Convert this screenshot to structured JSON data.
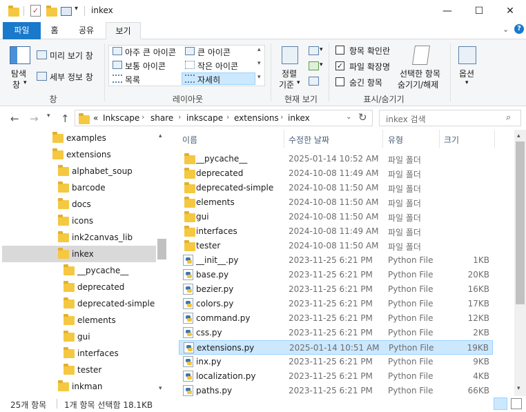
{
  "window": {
    "title": "inkex",
    "minimize": "—",
    "maximize": "☐",
    "close": "✕"
  },
  "tabs": [
    {
      "label": "파일"
    },
    {
      "label": "홈"
    },
    {
      "label": "공유"
    },
    {
      "label": "보기"
    }
  ],
  "ribbon": {
    "pane_group": {
      "nav_pane_label1": "탐색",
      "nav_pane_label2": "창",
      "preview_pane": "미리 보기 창",
      "details_pane": "세부 정보 창",
      "group_label": "창"
    },
    "layout_group": {
      "extra_large": "아주 큰 아이콘",
      "large": "큰 아이콘",
      "medium": "보통 아이콘",
      "small": "작은 아이콘",
      "list": "목록",
      "details": "자세히",
      "group_label": "레이아웃"
    },
    "view_group": {
      "sort_label1": "정렬",
      "sort_label2": "기준",
      "group_label": "현재 보기"
    },
    "show_hide_group": {
      "item_checkboxes": "항목 확인란",
      "item_checkboxes_checked": false,
      "file_extensions": "파일 확장명",
      "file_extensions_checked": true,
      "hidden_items": "숨긴 항목",
      "hidden_items_checked": false,
      "hide_selected1": "선택한 항목",
      "hide_selected2": "숨기기/해제",
      "group_label": "표시/숨기기"
    },
    "options": {
      "label": "옵션"
    }
  },
  "address": {
    "overflow": "«",
    "crumbs": [
      "Inkscape",
      "share",
      "inkscape",
      "extensions",
      "inkex"
    ],
    "search_placeholder": "inkex 검색"
  },
  "nav_tree": [
    {
      "label": "examples",
      "level": 0
    },
    {
      "label": "extensions",
      "level": 0
    },
    {
      "label": "alphabet_soup",
      "level": 1
    },
    {
      "label": "barcode",
      "level": 1
    },
    {
      "label": "docs",
      "level": 1
    },
    {
      "label": "icons",
      "level": 1
    },
    {
      "label": "ink2canvas_lib",
      "level": 1
    },
    {
      "label": "inkex",
      "level": 1,
      "selected": true
    },
    {
      "label": "__pycache__",
      "level": 2
    },
    {
      "label": "deprecated",
      "level": 2
    },
    {
      "label": "deprecated-simple",
      "level": 2
    },
    {
      "label": "elements",
      "level": 2
    },
    {
      "label": "gui",
      "level": 2
    },
    {
      "label": "interfaces",
      "level": 2
    },
    {
      "label": "tester",
      "level": 2
    },
    {
      "label": "inkman",
      "level": 1
    }
  ],
  "columns": {
    "name": "이름",
    "date": "수정한 날짜",
    "type": "유형",
    "size": "크기"
  },
  "files": [
    {
      "name": "__pycache__",
      "date": "2025-01-14 10:52 AM",
      "type": "파일 폴더",
      "size": "",
      "kind": "folder"
    },
    {
      "name": "deprecated",
      "date": "2024-10-08 11:49 AM",
      "type": "파일 폴더",
      "size": "",
      "kind": "folder"
    },
    {
      "name": "deprecated-simple",
      "date": "2024-10-08 11:50 AM",
      "type": "파일 폴더",
      "size": "",
      "kind": "folder"
    },
    {
      "name": "elements",
      "date": "2024-10-08 11:50 AM",
      "type": "파일 폴더",
      "size": "",
      "kind": "folder"
    },
    {
      "name": "gui",
      "date": "2024-10-08 11:50 AM",
      "type": "파일 폴더",
      "size": "",
      "kind": "folder"
    },
    {
      "name": "interfaces",
      "date": "2024-10-08 11:49 AM",
      "type": "파일 폴더",
      "size": "",
      "kind": "folder"
    },
    {
      "name": "tester",
      "date": "2024-10-08 11:50 AM",
      "type": "파일 폴더",
      "size": "",
      "kind": "folder"
    },
    {
      "name": "__init__.py",
      "date": "2023-11-25 6:21 PM",
      "type": "Python File",
      "size": "1KB",
      "kind": "py"
    },
    {
      "name": "base.py",
      "date": "2023-11-25 6:21 PM",
      "type": "Python File",
      "size": "20KB",
      "kind": "py"
    },
    {
      "name": "bezier.py",
      "date": "2023-11-25 6:21 PM",
      "type": "Python File",
      "size": "16KB",
      "kind": "py"
    },
    {
      "name": "colors.py",
      "date": "2023-11-25 6:21 PM",
      "type": "Python File",
      "size": "17KB",
      "kind": "py"
    },
    {
      "name": "command.py",
      "date": "2023-11-25 6:21 PM",
      "type": "Python File",
      "size": "12KB",
      "kind": "py"
    },
    {
      "name": "css.py",
      "date": "2023-11-25 6:21 PM",
      "type": "Python File",
      "size": "2KB",
      "kind": "py"
    },
    {
      "name": "extensions.py",
      "date": "2025-01-14 10:51 AM",
      "type": "Python File",
      "size": "19KB",
      "kind": "py",
      "selected": true
    },
    {
      "name": "inx.py",
      "date": "2023-11-25 6:21 PM",
      "type": "Python File",
      "size": "9KB",
      "kind": "py"
    },
    {
      "name": "localization.py",
      "date": "2023-11-25 6:21 PM",
      "type": "Python File",
      "size": "4KB",
      "kind": "py"
    },
    {
      "name": "paths.py",
      "date": "2023-11-25 6:21 PM",
      "type": "Python File",
      "size": "66KB",
      "kind": "py"
    }
  ],
  "status": {
    "count": "25개 항목",
    "selection": "1개 항목 선택함 18.1KB"
  },
  "colors": {
    "accent": "#1979ca",
    "selection": "#cce8ff",
    "folder": "#f5c842"
  }
}
